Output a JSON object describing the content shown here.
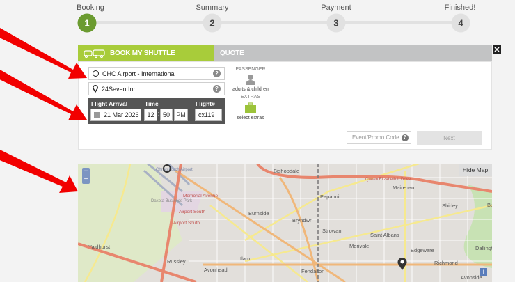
{
  "steps": [
    {
      "label": "Booking",
      "number": "1",
      "active": true
    },
    {
      "label": "Summary",
      "number": "2"
    },
    {
      "label": "Payment",
      "number": "3"
    },
    {
      "label": "Finished!",
      "number": "4"
    }
  ],
  "tabs": {
    "book": "BOOK MY SHUTTLE",
    "quote": "QUOTE",
    "close_icon": "close-icon"
  },
  "form": {
    "pickup": "CHC Airport - International",
    "dropoff": "24Seven Inn",
    "help": "?",
    "flight_arrival_label": "Flight Arrival",
    "time_label": "Time",
    "flight_label": "Flight#",
    "date": "21 Mar 2026",
    "hour": "12",
    "sep": ":",
    "minute": "50",
    "ampm": "PM",
    "flight": "cx119",
    "passenger_label": "PASSENGER",
    "passenger_value": "adults & children",
    "extras_label": "EXTRAS",
    "extras_value": "select extras",
    "promo": "Event/Promo Code",
    "next": "Next"
  },
  "map": {
    "hide": "Hide Map",
    "zoom_in": "+",
    "zoom_out": "−",
    "info": "i",
    "labels": [
      "Christchurch Airport",
      "Bishopdale",
      "Dakota Business Park",
      "Memorial Avenue",
      "Airport South",
      "Airport South",
      "Burnside",
      "Bryndwr",
      "Yaldhurst",
      "Russley",
      "Avonhead",
      "Ilam",
      "Fendalton",
      "Papanui",
      "Strowan",
      "Merivale",
      "Saint Albans",
      "Queen Elizabeth II Drive",
      "Mairehau",
      "Shirley",
      "Edgeware",
      "Richmond",
      "Dallington",
      "Avonside",
      "Burwood"
    ]
  },
  "colors": {
    "accent": "#a8cc3a",
    "step_active": "#6b9b30",
    "arrow": "#ff0000"
  }
}
